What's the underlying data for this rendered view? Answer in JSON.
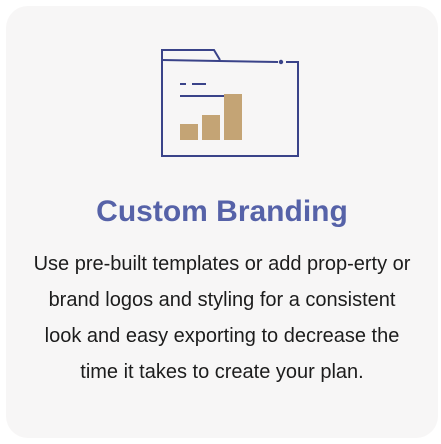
{
  "feature": {
    "icon": "branding-dashboard-icon",
    "title": "Custom Branding",
    "description": "Use pre-built templates or add prop-erty or brand logos and styling for a consistent look and easy exporting to decrease the time it takes to create your plan."
  },
  "colors": {
    "card_background": "#f7f6f6",
    "title": "#5662a8",
    "icon_outline": "#3a4389",
    "icon_bars": "#c4a475",
    "text": "#1c1c1c"
  },
  "chart_preview": {
    "bar_levels": [
      0.35,
      0.55,
      1.0
    ]
  }
}
